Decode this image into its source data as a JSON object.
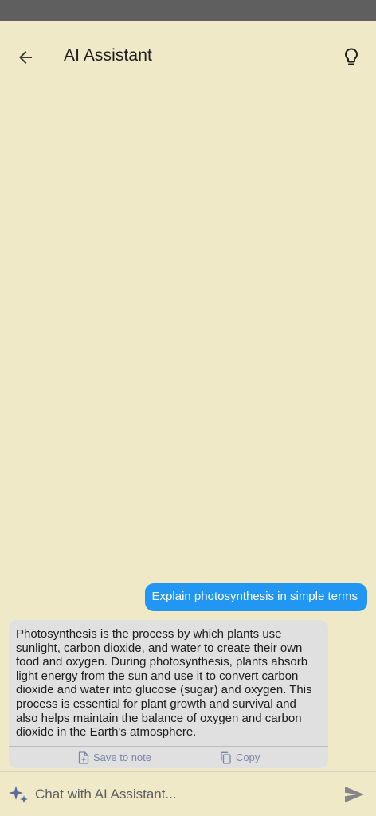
{
  "header": {
    "title": "AI Assistant",
    "back_icon": "arrow-left-icon",
    "hint_icon": "lightbulb-icon"
  },
  "messages": [
    {
      "role": "user",
      "text": "Explain photosynthesis in simple terms"
    },
    {
      "role": "assistant",
      "text": "Photosynthesis is the process by which plants use sunlight, carbon dioxide, and water to create their own food and oxygen. During photosynthesis, plants absorb light energy from the sun and use it to convert carbon dioxide and water into glucose (sugar) and oxygen. This process is essential for plant growth and survival and also helps maintain the balance of oxygen and carbon dioxide in the Earth's atmosphere.",
      "actions": {
        "save_label": "Save to note",
        "copy_label": "Copy"
      }
    }
  ],
  "composer": {
    "placeholder": "Chat with AI Assistant...",
    "value": ""
  },
  "colors": {
    "background": "#efe9c7",
    "user_bubble": "#2196f3",
    "assistant_bubble": "#e0e0e0",
    "action_text": "#7a86a6",
    "status_bar": "#5f5f5f"
  }
}
